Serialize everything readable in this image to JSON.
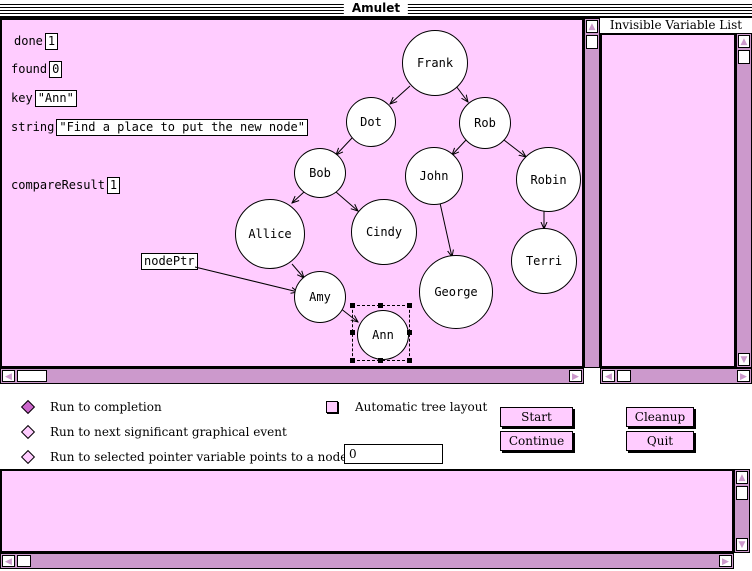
{
  "window": {
    "title": "Amulet"
  },
  "variables": [
    {
      "name": "done",
      "value": "1"
    },
    {
      "name": "found",
      "value": "0"
    },
    {
      "name": "key",
      "value": "\"Ann\""
    },
    {
      "name": "string",
      "value": "\"Find a place to put the new node\""
    },
    {
      "name": "compareResult",
      "value": "1"
    }
  ],
  "pointer": {
    "label": "nodePtr"
  },
  "tree": {
    "nodes": [
      "Frank",
      "Dot",
      "Rob",
      "Bob",
      "John",
      "Robin",
      "Allice",
      "Cindy",
      "Terri",
      "Amy",
      "George",
      "Ann"
    ],
    "selected": "Ann"
  },
  "invisible_list": {
    "title": "Invisible Variable List"
  },
  "controls": {
    "run_completion": "Run to completion",
    "run_next_event": "Run to next significant graphical event",
    "run_pointer": "Run to selected pointer variable points to a node with key",
    "key_value": "0",
    "auto_layout": "Automatic tree layout",
    "start": "Start",
    "continue": "Continue",
    "cleanup": "Cleanup",
    "quit": "Quit"
  },
  "colors": {
    "pane": "#ffccff",
    "scroll": "#cc99cc",
    "radio": "#cc66cc"
  }
}
